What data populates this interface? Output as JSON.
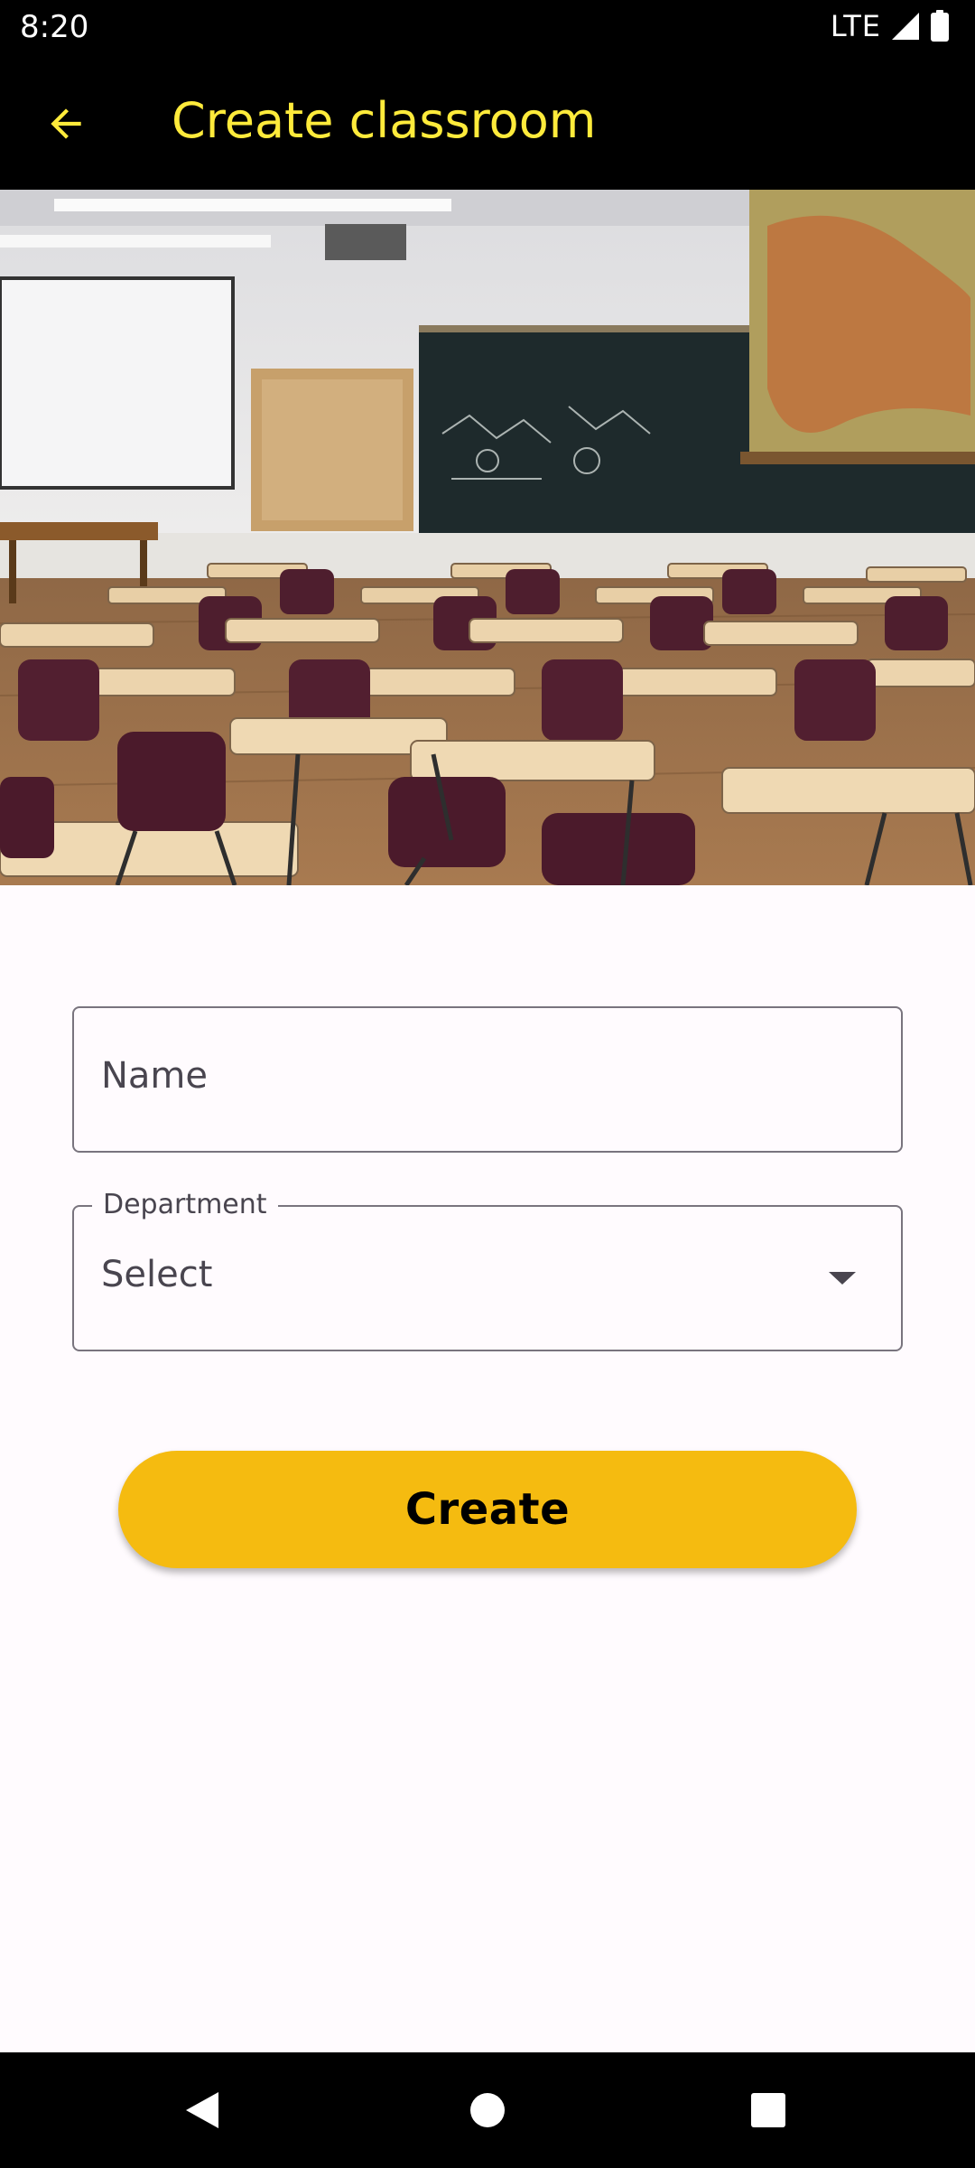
{
  "status_bar": {
    "time": "8:20",
    "network": "LTE",
    "icons": [
      "signal-icon",
      "battery-icon"
    ]
  },
  "app_bar": {
    "title": "Create classroom",
    "back_icon": "arrow-left-icon",
    "accent_color": "#ffeb3b"
  },
  "hero": {
    "image": "classroom-photo"
  },
  "form": {
    "name_field": {
      "placeholder": "Name",
      "value": ""
    },
    "department_field": {
      "label": "Department",
      "selected": "Select",
      "icon": "dropdown-arrow-icon"
    },
    "create_button": {
      "label": "Create",
      "color": "#f5bb10"
    }
  },
  "nav_bar": {
    "buttons": [
      "back-triangle-icon",
      "home-circle-icon",
      "recents-square-icon"
    ]
  }
}
